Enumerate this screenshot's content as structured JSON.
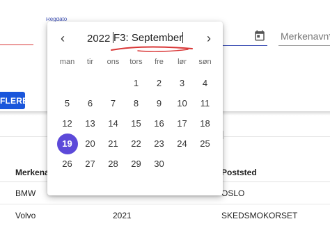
{
  "form": {
    "hidden_label": "Regdato",
    "brand_placeholder": "Merkenavn*",
    "more_button": "FLERE"
  },
  "table": {
    "headers": [
      "Merkena",
      "Poststed"
    ],
    "rows": [
      {
        "brand": "BMW",
        "year": "",
        "place": "OSLO"
      },
      {
        "brand": "Volvo",
        "year": "2021",
        "place": "SKEDSMOKORSET"
      }
    ]
  },
  "datepicker": {
    "prev_label": "‹",
    "next_label": "›",
    "year": "2022",
    "month": "F3: September",
    "weekdays": [
      "man",
      "tir",
      "ons",
      "tors",
      "fre",
      "lør",
      "søn"
    ],
    "days": [
      "1",
      "2",
      "3",
      "4",
      "5",
      "6",
      "7",
      "8",
      "9",
      "10",
      "11",
      "12",
      "13",
      "14",
      "15",
      "16",
      "17",
      "18",
      "19",
      "20",
      "21",
      "22",
      "23",
      "24",
      "25",
      "26",
      "27",
      "28",
      "29",
      "30"
    ],
    "first_weekday_index": 3,
    "selected_day": "19",
    "selected_color": "#5c49d9",
    "annotation_color": "#d93636"
  },
  "icons": {
    "calendar": "calendar-icon",
    "prev": "chevron-left-icon",
    "next": "chevron-right-icon"
  }
}
